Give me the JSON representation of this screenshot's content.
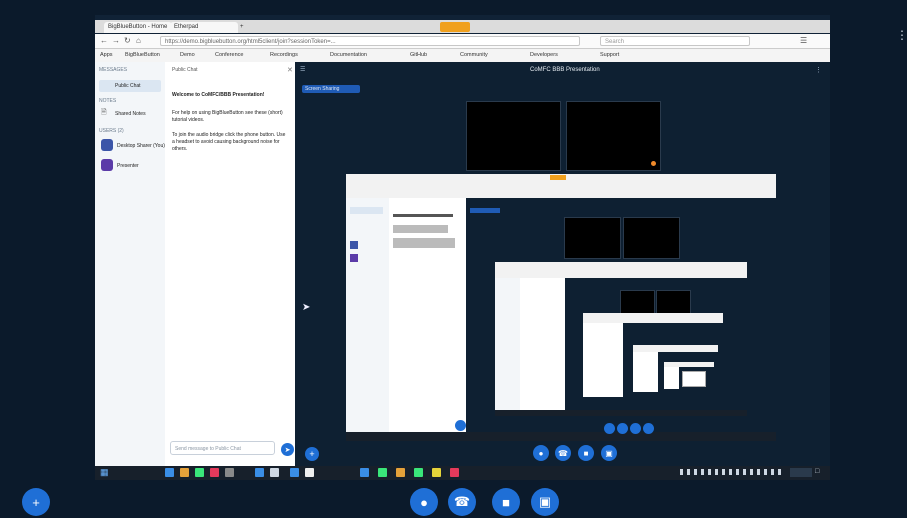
{
  "browser": {
    "tabs": [
      "BigBlueButton - Home",
      "Etherpad",
      "+"
    ],
    "url": "https://demo.bigbluebutton.org/html5client/join?sessionToken=...",
    "search_placeholder": "Search",
    "bookmarks": [
      "Apps",
      "BigBlueButton",
      "Demo",
      "Conference",
      "Recordings",
      "Documentation",
      "GitHub",
      "Community",
      "Developers",
      "Support"
    ]
  },
  "sidebar": {
    "messages_header": "MESSAGES",
    "public_chat": "Public Chat",
    "notes_header": "NOTES",
    "shared_notes": "Shared Notes",
    "users_header": "USERS (2)",
    "users": [
      "Desktop Sharer (You)",
      "Presenter"
    ]
  },
  "chat": {
    "title": "Public Chat",
    "welcome": "Welcome to CoMFC/BBB Presentation!",
    "help": "For help on using BigBlueButton see these (short) tutorial videos.",
    "audio": "To join the audio bridge click the phone button. Use a headset to avoid causing background noise for others.",
    "input_placeholder": "Send message to Public Chat"
  },
  "main": {
    "title": "CoMFC BBB Presentation",
    "presenter_label": "Screen Sharing"
  },
  "conference_controls": [
    "mic",
    "phone",
    "video",
    "screen"
  ],
  "colors": {
    "accent": "#1f6fd6",
    "dark": "#0b1a2b"
  }
}
